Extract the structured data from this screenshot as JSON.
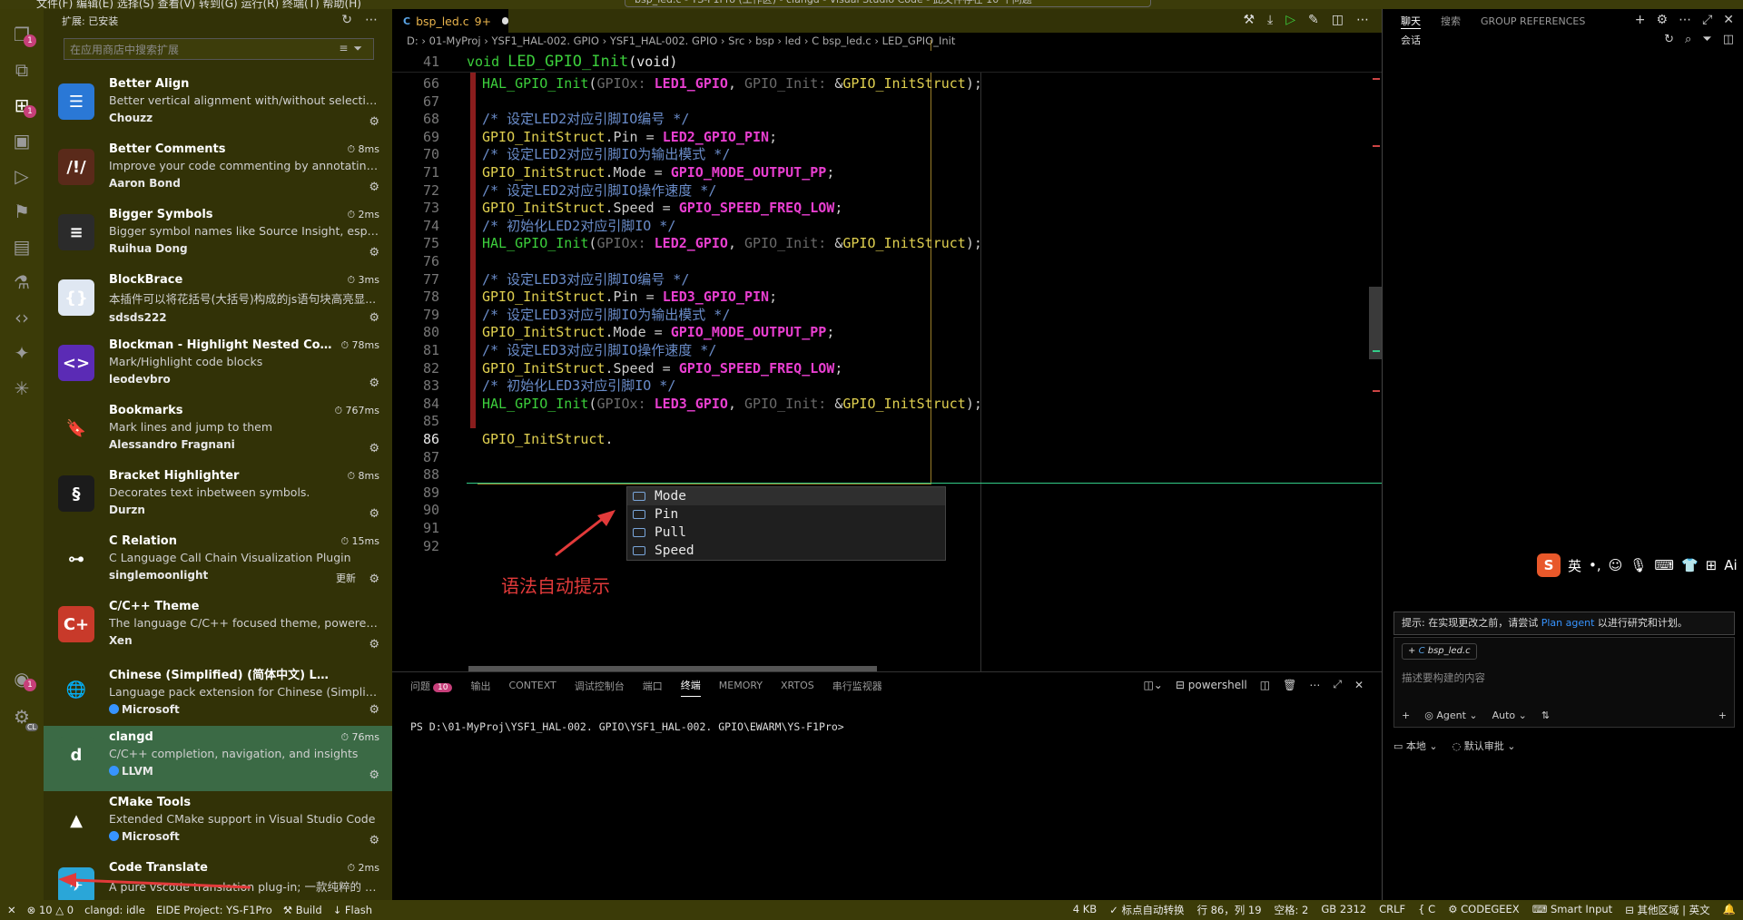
{
  "window": {
    "menu": [
      "文件(F)",
      "编辑(E)",
      "选择(S)",
      "查看(V)",
      "转到(G)",
      "运行(R)",
      "终端(T)",
      "帮助(H)"
    ],
    "search_text": "bsp_led.c - YS-F1Pro (工作区) - clangd - Visual Studio Code - 此文件存在 10 个问题"
  },
  "activity_bar": {
    "items": [
      {
        "name": "explorer-icon",
        "badge": "1"
      },
      {
        "name": "remote-icon",
        "badge": ""
      },
      {
        "name": "extensions-icon",
        "badge": "1"
      },
      {
        "name": "chip-icon",
        "badge": ""
      },
      {
        "name": "run-debug-icon",
        "badge": ""
      },
      {
        "name": "bookmark-icon",
        "badge": ""
      },
      {
        "name": "notes-icon",
        "badge": ""
      },
      {
        "name": "test-icon",
        "badge": ""
      },
      {
        "name": "code-icon",
        "badge": ""
      },
      {
        "name": "chat-icon",
        "badge": ""
      },
      {
        "name": "tree-icon",
        "badge": ""
      }
    ],
    "account_badge": "1",
    "settings_label": "CL"
  },
  "sidebar": {
    "title": "扩展: 已安装",
    "search_placeholder": "在应用商店中搜索扩展",
    "extensions": [
      {
        "name": "Better Align",
        "desc": "Better vertical alignment with/without selection in ...",
        "publisher": "Chouzz",
        "time": "",
        "color": "#2a78d6",
        "glyph": "☰",
        "verified": false,
        "update": ""
      },
      {
        "name": "Better Comments",
        "desc": "Improve your code commenting by annotating wit...",
        "publisher": "Aaron Bond",
        "time": "8ms",
        "color": "#5a2a1a",
        "glyph": "/!/",
        "verified": false,
        "update": ""
      },
      {
        "name": "Bigger Symbols",
        "desc": "Bigger symbol names like Source Insight, especiall...",
        "publisher": "Ruihua Dong",
        "time": "2ms",
        "color": "#2b2b2b",
        "glyph": "≡",
        "verified": false,
        "update": ""
      },
      {
        "name": "BlockBrace",
        "desc": "本插件可以将花括号(大括号)构成的js语句块高亮显...",
        "publisher": "sdsds222",
        "time": "3ms",
        "color": "#dfe7f2",
        "glyph": "{}",
        "verified": false,
        "update": ""
      },
      {
        "name": "Blockman - Highlight Nested Code Bl...",
        "desc": "Mark/Highlight code blocks",
        "publisher": "leodevbro",
        "time": "78ms",
        "color": "#5b2bb5",
        "glyph": "<>",
        "verified": false,
        "update": ""
      },
      {
        "name": "Bookmarks",
        "desc": "Mark lines and jump to them",
        "publisher": "Alessandro Fragnani",
        "time": "767ms",
        "color": "#323207",
        "glyph": "🔖",
        "verified": false,
        "update": ""
      },
      {
        "name": "Bracket Highlighter",
        "desc": "Decorates text inbetween symbols.",
        "publisher": "Durzn",
        "time": "8ms",
        "color": "#1b1b1b",
        "glyph": "§",
        "verified": false,
        "update": ""
      },
      {
        "name": "C Relation",
        "desc": "C Language Call Chain Visualization Plugin",
        "publisher": "singlemoonlight",
        "time": "15ms",
        "color": "#323207",
        "glyph": "⊶",
        "verified": false,
        "update": "更新"
      },
      {
        "name": "C/C++ Theme",
        "desc": "The language C/C++ focused theme, powered by ...",
        "publisher": "Xen",
        "time": "",
        "color": "#c83a2a",
        "glyph": "C+",
        "verified": false,
        "update": ""
      },
      {
        "name": "Chinese (Simplified) (简体中文) Language Pac...",
        "desc": "Language pack extension for Chinese (Simplified)",
        "publisher": "Microsoft",
        "time": "",
        "color": "#323207",
        "glyph": "🌐",
        "verified": true,
        "update": ""
      },
      {
        "name": "clangd",
        "desc": "C/C++ completion, navigation, and insights",
        "publisher": "LLVM",
        "time": "76ms",
        "color": "#3b6a45",
        "glyph": "d",
        "verified": true,
        "update": ""
      },
      {
        "name": "CMake Tools",
        "desc": "Extended CMake support in Visual Studio Code",
        "publisher": "Microsoft",
        "time": "",
        "color": "#323207",
        "glyph": "▲",
        "verified": true,
        "update": ""
      },
      {
        "name": "Code Translate",
        "desc": "A pure vscode translation plug-in; 一款纯粹的 vsco...",
        "publisher": "",
        "time": "2ms",
        "color": "#2aa6d8",
        "glyph": "✈",
        "verified": false,
        "update": ""
      }
    ]
  },
  "editor": {
    "tab": {
      "label": "bsp_led.c",
      "problems": "9+"
    },
    "breadcrumb": "D: › 01-MyProj › YSF1_HAL-002. GPIO › YSF1_HAL-002. GPIO › Src › bsp › led › C bsp_led.c › LED_GPIO_Init",
    "sticky": {
      "num": "41",
      "kw": "void",
      "fn": "LED_GPIO_Init",
      "rest": "(void)"
    },
    "lines": [
      {
        "num": "66",
        "text": "HAL_GPIO_Init(GPIOx: LED1_GPIO, GPIO_Init: &GPIO_InitStruct);"
      },
      {
        "num": "67",
        "text": ""
      },
      {
        "num": "68",
        "text": "/* 设定LED2对应引脚IO编号 */"
      },
      {
        "num": "69",
        "text": "GPIO_InitStruct.Pin = LED2_GPIO_PIN;"
      },
      {
        "num": "70",
        "text": "/* 设定LED2对应引脚IO为输出模式 */"
      },
      {
        "num": "71",
        "text": "GPIO_InitStruct.Mode = GPIO_MODE_OUTPUT_PP;"
      },
      {
        "num": "72",
        "text": "/* 设定LED2对应引脚IO操作速度 */"
      },
      {
        "num": "73",
        "text": "GPIO_InitStruct.Speed = GPIO_SPEED_FREQ_LOW;"
      },
      {
        "num": "74",
        "text": "/* 初始化LED2对应引脚IO */"
      },
      {
        "num": "75",
        "text": "HAL_GPIO_Init(GPIOx: LED2_GPIO, GPIO_Init: &GPIO_InitStruct);"
      },
      {
        "num": "76",
        "text": ""
      },
      {
        "num": "77",
        "text": "/* 设定LED3对应引脚IO编号 */"
      },
      {
        "num": "78",
        "text": "GPIO_InitStruct.Pin = LED3_GPIO_PIN;"
      },
      {
        "num": "79",
        "text": "/* 设定LED3对应引脚IO为输出模式 */"
      },
      {
        "num": "80",
        "text": "GPIO_InitStruct.Mode = GPIO_MODE_OUTPUT_PP;"
      },
      {
        "num": "81",
        "text": "/* 设定LED3对应引脚IO操作速度 */"
      },
      {
        "num": "82",
        "text": "GPIO_InitStruct.Speed = GPIO_SPEED_FREQ_LOW;"
      },
      {
        "num": "83",
        "text": "/* 初始化LED3对应引脚IO */"
      },
      {
        "num": "84",
        "text": "HAL_GPIO_Init(GPIOx: LED3_GPIO, GPIO_Init: &GPIO_InitStruct);"
      },
      {
        "num": "85",
        "text": ""
      },
      {
        "num": "86",
        "text": "GPIO_InitStruct."
      },
      {
        "num": "87",
        "text": ""
      },
      {
        "num": "88",
        "text": ""
      },
      {
        "num": "89",
        "text": ""
      },
      {
        "num": "90",
        "text": ""
      },
      {
        "num": "91",
        "text": ""
      },
      {
        "num": "92",
        "text": ""
      }
    ],
    "suggestions": [
      "Mode",
      "Pin",
      "Pull",
      "Speed"
    ],
    "annotation": "语法自动提示"
  },
  "panel": {
    "tabs": [
      "问题",
      "输出",
      "CONTEXT",
      "调试控制台",
      "端口",
      "终端",
      "MEMORY",
      "XRTOS",
      "串行监视器"
    ],
    "problems_badge": "10",
    "active_tab": "终端",
    "shell": "powershell",
    "prompt": "PS D:\\01-MyProj\\YSF1_HAL-002. GPIO\\YSF1_HAL-002. GPIO\\EWARM\\YS-F1Pro>"
  },
  "chat": {
    "tabs": [
      "聊天",
      "搜索",
      "GROUP REFERENCES"
    ],
    "session_label": "会话",
    "ime": "英",
    "tip_prefix": "提示: 在实现更改之前，请尝试",
    "tip_link": "Plan agent",
    "tip_suffix": "以进行研究和计划。",
    "file_chip": "bsp_led.c",
    "placeholder": "描述要构建的内容",
    "agent_label": "Agent",
    "auto_label": "Auto",
    "local_label": "本地",
    "approve_label": "默认审批"
  },
  "status": {
    "problems": "10",
    "warnings": "0",
    "clangd": "clangd: idle",
    "eide": "EIDE Project: YS-F1Pro",
    "build": "Build",
    "flash": "Flash",
    "size": "4 KB",
    "punct": "标点自动转换",
    "position": "行 86，列 19",
    "spaces": "空格: 2",
    "encoding": "GB 2312",
    "eol": "CRLF",
    "lang": "C",
    "codegeex": "CODEGEEX",
    "smart_input": "Smart Input",
    "region": "其他区域 | 英文"
  }
}
